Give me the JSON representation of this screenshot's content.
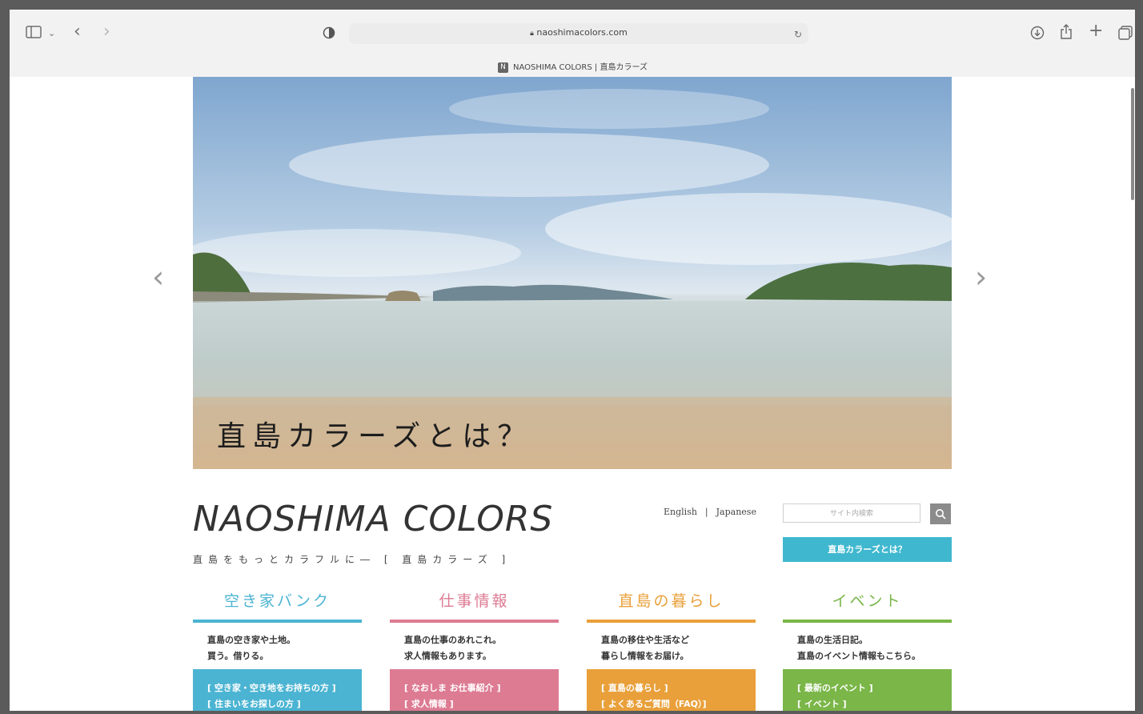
{
  "browser": {
    "url": "naoshimacolors.com",
    "tab_title": "NAOSHIMA COLORS | 直島カラーズ",
    "favicon_letter": "N",
    "icons": [
      "sidebar-icon",
      "chevron-down-icon",
      "back-icon",
      "forward-icon",
      "shield-icon",
      "lock-icon",
      "reload-icon",
      "download-icon",
      "share-icon",
      "new-tab-icon",
      "tabs-overview-icon"
    ]
  },
  "hero": {
    "caption": "直島カラーズとは？",
    "prev_arrow": "‹",
    "next_arrow": "›"
  },
  "site": {
    "title": "NAOSHIMA COLORS",
    "subtitle": "直島をもっとカラフルに―  [ 直島カラーズ ]",
    "lang_english": "English",
    "lang_sep": "|",
    "lang_japanese": "Japanese",
    "search_placeholder": "サイト内検索",
    "about_button": "直島カラーズとは？"
  },
  "categories": [
    {
      "title": "空き家バンク",
      "color": "#4bb4d2",
      "desc1": "直島の空き家や土地。",
      "desc2": "買う。借りる。",
      "link1": "[ 空き家・空き地をお持ちの方 ]",
      "link2": "[ 住まいをお探しの方 ]"
    },
    {
      "title": "仕事情報",
      "color": "#dd7b93",
      "desc1": "直島の仕事のあれこれ。",
      "desc2": "求人情報もあります。",
      "link1": "[ なおしま お仕事紹介 ]",
      "link2": "[ 求人情報 ]"
    },
    {
      "title": "直島の暮らし",
      "color": "#e9a03a",
      "desc1": "直島の移住や生活など",
      "desc2": "暮らし情報をお届け。",
      "link1": "[ 直島の暮らし ]",
      "link2": "[ よくあるご質問（FAQ）]"
    },
    {
      "title": "イベント",
      "color": "#7ab648",
      "desc1": "直島の生活日記。",
      "desc2": "直島のイベント情報もこちら。",
      "link1": "[ 最新のイベント ]",
      "link2": "[ イベント ]"
    }
  ]
}
